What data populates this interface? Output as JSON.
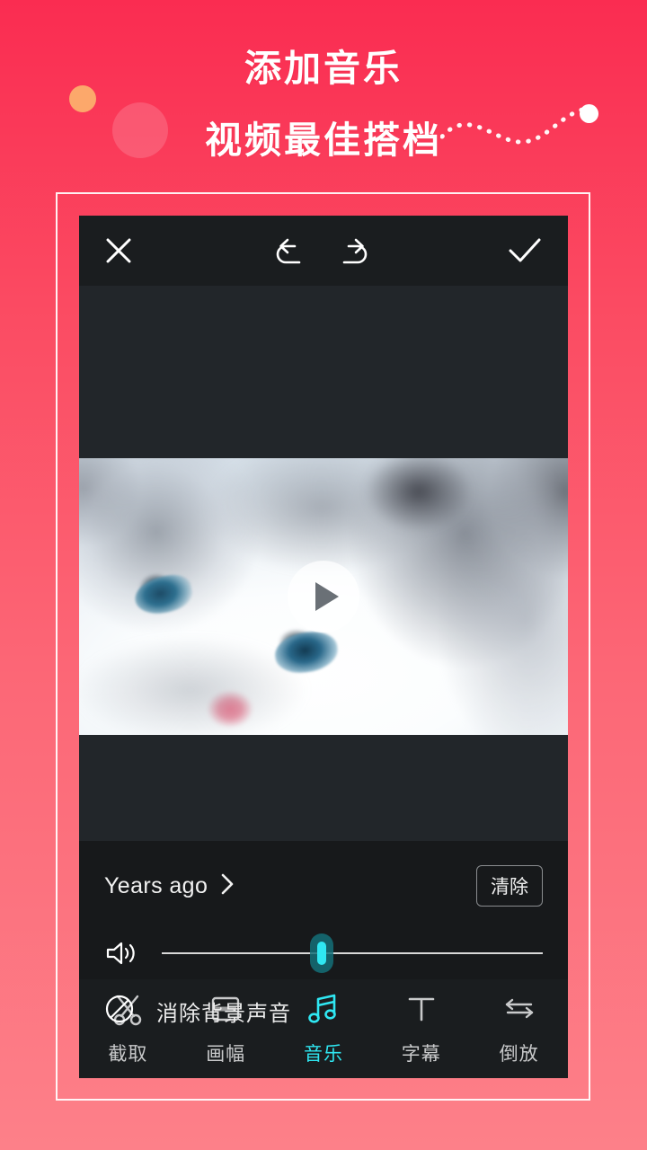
{
  "poster": {
    "headline_line1": "添加音乐",
    "headline_line2": "视频最佳搭档",
    "bg_color_top": "#FA2C51",
    "bg_color_bottom": "#FD8089",
    "circle_orange_color": "#FCA86B",
    "circle_pink_color": "rgba(255,255,255,0.16)",
    "dot_color": "#FFFFFF"
  },
  "app": {
    "top_bar": {
      "close_icon": "close-x-icon",
      "undo_icon": "undo-arrow-icon",
      "redo_icon": "redo-arrow-icon",
      "confirm_icon": "checkmark-icon"
    },
    "video": {
      "play_icon": "play-triangle-icon",
      "subject": "close-up of white and grey ragdoll cat with blue eyes",
      "letterbox_color": "#22262A"
    },
    "music_panel": {
      "track_name": "Years ago",
      "track_chevron_icon": "chevron-right-icon",
      "clear_label": "清除",
      "volume_icon": "speaker-volume-icon",
      "volume_percent": 42,
      "mute_icon": "no-entry-circle-slash-icon",
      "mute_label": "消除背景声音",
      "accent_color": "#2FE7F2"
    },
    "bottom_nav": {
      "active_index": 2,
      "items": [
        {
          "label": "截取",
          "icon": "scissors-icon"
        },
        {
          "label": "画幅",
          "icon": "crop-frame-icon"
        },
        {
          "label": "音乐",
          "icon": "music-note-icon"
        },
        {
          "label": "字幕",
          "icon": "text-subtitle-icon"
        },
        {
          "label": "倒放",
          "icon": "reverse-arrows-icon"
        }
      ]
    }
  }
}
